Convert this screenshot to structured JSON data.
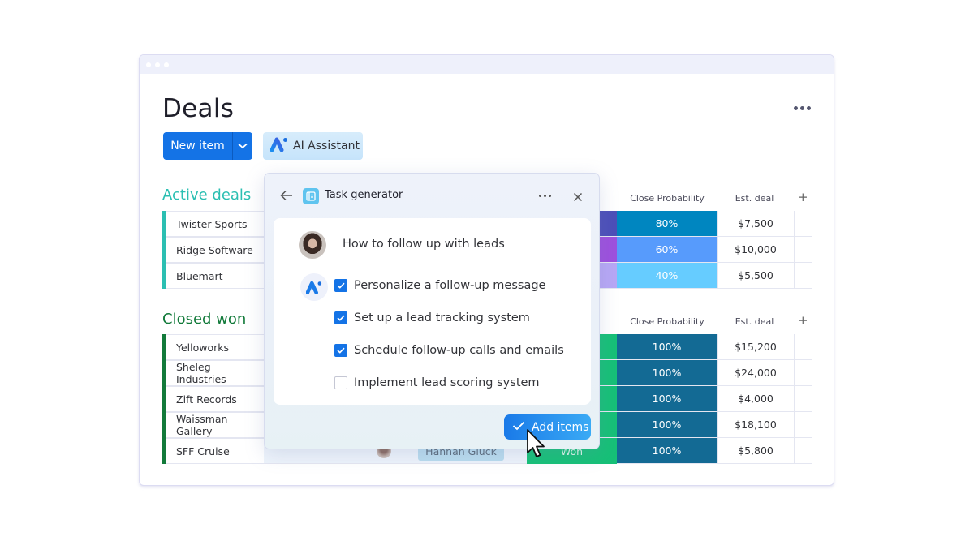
{
  "window": {
    "controls": [
      "dot",
      "dot",
      "dot"
    ]
  },
  "header": {
    "title": "Deals",
    "more_icon": "more-horizontal-icon",
    "new_item_label": "New item",
    "ai_assistant_label": "AI Assistant"
  },
  "columns": {
    "close_probability": "Close Probability",
    "est_deal": "Est. deal",
    "add": "+"
  },
  "groups": [
    {
      "title": "Active deals",
      "color": "#2bbfb2",
      "rows": [
        {
          "name": "Twister Sports",
          "stage_color": "#4c4fb8",
          "probability": "80%",
          "prob_color": "#0086c0",
          "est_deal": "$7,500"
        },
        {
          "name": "Ridge Software",
          "stage_color": "#9d50dd",
          "probability": "60%",
          "prob_color": "#579bfc",
          "est_deal": "$10,000"
        },
        {
          "name": "Bluemart",
          "stage_color": "#b7a7f5",
          "probability": "40%",
          "prob_color": "#66ccff",
          "est_deal": "$5,500"
        }
      ]
    },
    {
      "title": "Closed won",
      "color": "#127a3a",
      "rows": [
        {
          "name": "Yelloworks",
          "stage_color": "#16c077",
          "probability": "100%",
          "prob_color": "#136a94",
          "est_deal": "$15,200"
        },
        {
          "name": "Sheleg Industries",
          "stage_color": "#16c077",
          "probability": "100%",
          "prob_color": "#136a94",
          "est_deal": "$24,000"
        },
        {
          "name": "Zift Records",
          "stage_color": "#16c077",
          "probability": "100%",
          "prob_color": "#136a94",
          "est_deal": "$4,000"
        },
        {
          "name": "Waissman Gallery",
          "stage_color": "#16c077",
          "probability": "100%",
          "prob_color": "#136a94",
          "est_deal": "$18,100"
        },
        {
          "name": "SFF Cruise",
          "stage_color": "#16c077",
          "probability": "100%",
          "prob_color": "#136a94",
          "est_deal": "$5,800",
          "owner": "Hannah Gluck",
          "status": "Won"
        }
      ]
    }
  ],
  "popup": {
    "title": "Task generator",
    "prompt": "How to follow up with leads",
    "tasks": [
      {
        "label": "Personalize a follow-up message",
        "checked": true
      },
      {
        "label": "Set up a lead tracking system",
        "checked": true
      },
      {
        "label": "Schedule follow-up calls and emails",
        "checked": true
      },
      {
        "label": "Implement lead scoring system",
        "checked": false
      }
    ],
    "add_button_label": "Add items"
  }
}
